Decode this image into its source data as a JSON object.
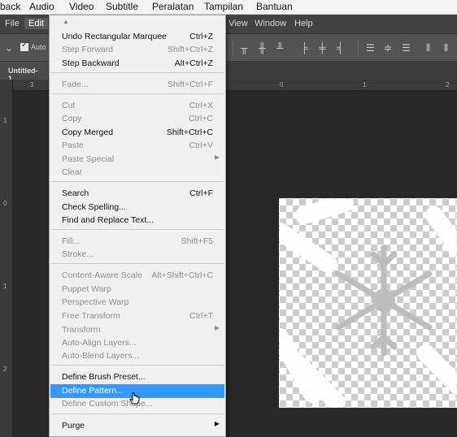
{
  "player_menubar": {
    "items": [
      "back",
      "Audio",
      "Video",
      "Subtitle",
      "Peralatan",
      "Tampilan",
      "Bantuan"
    ]
  },
  "ps_menubar": {
    "items": [
      "File",
      "Edit",
      "View",
      "Window",
      "Help"
    ]
  },
  "options_bar": {
    "auto_label": "Auto"
  },
  "document_tab": "Untitled-1",
  "rulers": {
    "h_labels": [
      "3",
      "0",
      "1",
      "2"
    ],
    "v_labels": [
      "1",
      "0",
      "1",
      "2"
    ]
  },
  "edit_menu": {
    "items": [
      {
        "label": "Undo Rectangular Marquee",
        "shortcut": "Ctrl+Z",
        "enabled": true
      },
      {
        "label": "Step Forward",
        "shortcut": "Shift+Ctrl+Z",
        "enabled": false
      },
      {
        "label": "Step Backward",
        "shortcut": "Alt+Ctrl+Z",
        "enabled": true
      },
      {
        "label": "Fade...",
        "shortcut": "Shift+Ctrl+F",
        "enabled": false
      },
      {
        "label": "Cut",
        "shortcut": "Ctrl+X",
        "enabled": false
      },
      {
        "label": "Copy",
        "shortcut": "Ctrl+C",
        "enabled": false
      },
      {
        "label": "Copy Merged",
        "shortcut": "Shift+Ctrl+C",
        "enabled": true
      },
      {
        "label": "Paste",
        "shortcut": "Ctrl+V",
        "enabled": false
      },
      {
        "label": "Paste Special",
        "shortcut": "",
        "enabled": false,
        "submenu": true
      },
      {
        "label": "Clear",
        "shortcut": "",
        "enabled": false
      },
      {
        "label": "Search",
        "shortcut": "Ctrl+F",
        "enabled": true
      },
      {
        "label": "Check Spelling...",
        "shortcut": "",
        "enabled": true
      },
      {
        "label": "Find and Replace Text...",
        "shortcut": "",
        "enabled": true
      },
      {
        "label": "Fill...",
        "shortcut": "Shift+F5",
        "enabled": false
      },
      {
        "label": "Stroke...",
        "shortcut": "",
        "enabled": false
      },
      {
        "label": "Content-Aware Scale",
        "shortcut": "Alt+Shift+Ctrl+C",
        "enabled": false
      },
      {
        "label": "Puppet Warp",
        "shortcut": "",
        "enabled": false
      },
      {
        "label": "Perspective Warp",
        "shortcut": "",
        "enabled": false
      },
      {
        "label": "Free Transform",
        "shortcut": "Ctrl+T",
        "enabled": false
      },
      {
        "label": "Transform",
        "shortcut": "",
        "enabled": false,
        "submenu": true
      },
      {
        "label": "Auto-Align Layers...",
        "shortcut": "",
        "enabled": false
      },
      {
        "label": "Auto-Blend Layers...",
        "shortcut": "",
        "enabled": false
      },
      {
        "label": "Define Brush Preset...",
        "shortcut": "",
        "enabled": true
      },
      {
        "label": "Define Pattern...",
        "shortcut": "",
        "enabled": true,
        "highlighted": true
      },
      {
        "label": "Define Custom Shape...",
        "shortcut": "",
        "enabled": false
      },
      {
        "label": "Purge",
        "shortcut": "",
        "enabled": true,
        "submenu": true
      }
    ]
  },
  "colors": {
    "highlight": "#3399ff",
    "menu_bg": "#f0f0f0",
    "workspace": "#282828"
  }
}
